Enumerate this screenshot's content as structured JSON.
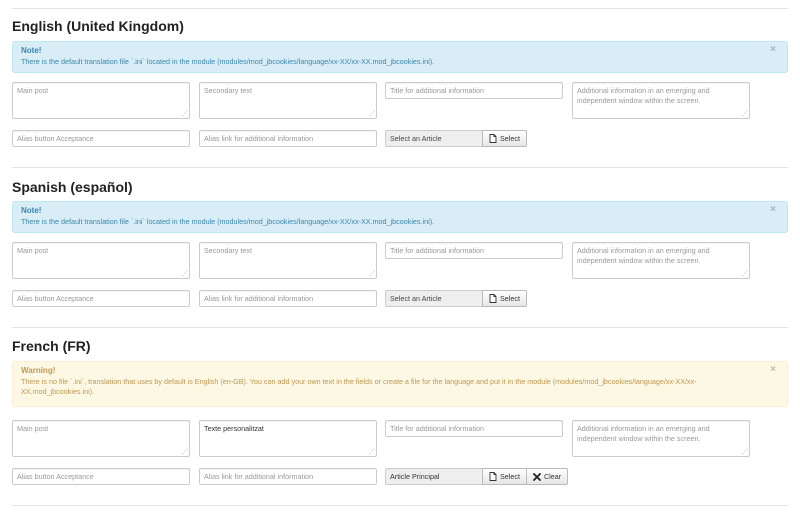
{
  "placeholders": {
    "main_post": "Main post",
    "secondary_text": "Secondary text",
    "title_info": "Title for additional information",
    "additional_info": "Additional information in an emerging and independent window within the screen.",
    "alias_button": "Alias button Acceptance",
    "alias_link": "Alias link for additional information"
  },
  "languages": [
    {
      "title": "English (United Kingdom)",
      "alert": {
        "heading": "Note!",
        "text": "There is the default translation file `.ini` located in the module (modules/mod_jbcookies/language/xx-XX/xx-XX.mod_jbcookies.ini).",
        "close": "×"
      },
      "main_post_value": "",
      "article": "Select an Article",
      "select_label": "Select"
    },
    {
      "title": "Spanish (español)",
      "alert": {
        "heading": "Note!",
        "text": "There is the default translation file `.ini` located in the module (modules/mod_jbcookies/language/xx-XX/xx-XX.mod_jbcookies.ini).",
        "close": "×"
      },
      "main_post_value": "",
      "article": "Select an Article",
      "select_label": "Select"
    },
    {
      "title": "French (FR)",
      "alert": {
        "heading": "Warning!",
        "text": "There is no file `.ini`, translation that uses by default is English (en-GB). You can add your own text in the fields or create a file for the language and put it in the module (modules/mod_jbcookies/language/xx-XX/xx-XX.mod_jbcookies.ini).",
        "close": "×"
      },
      "secondary_value": "Texte personalitzat",
      "article": "Article Principal",
      "select_label": "Select",
      "clear_label": "Clear"
    }
  ],
  "icons": {
    "select": "file-icon",
    "clear": "x-icon"
  }
}
